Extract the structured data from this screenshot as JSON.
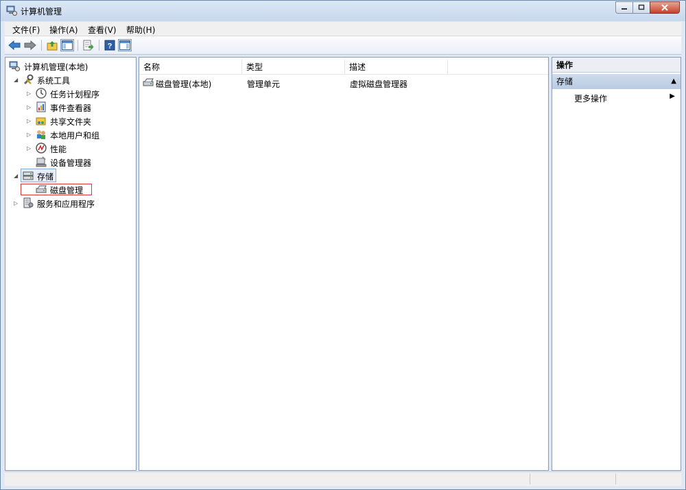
{
  "window": {
    "title": "计算机管理"
  },
  "menubar": {
    "items": [
      "文件(F)",
      "操作(A)",
      "查看(V)",
      "帮助(H)"
    ]
  },
  "tree": {
    "root": "计算机管理(本地)",
    "system_tools": "系统工具",
    "task_scheduler": "任务计划程序",
    "event_viewer": "事件查看器",
    "shared_folders": "共享文件夹",
    "local_users": "本地用户和组",
    "performance": "性能",
    "device_manager": "设备管理器",
    "storage": "存储",
    "disk_management": "磁盘管理",
    "services_apps": "服务和应用程序"
  },
  "list": {
    "columns": [
      "名称",
      "类型",
      "描述"
    ],
    "rows": [
      {
        "name": "磁盘管理(本地)",
        "type": "管理单元",
        "desc": "虚拟磁盘管理器"
      }
    ]
  },
  "actions": {
    "title": "操作",
    "section": "存储",
    "more": "更多操作"
  },
  "colors": {
    "selection_border": "#d43a3a",
    "accent": "#c4d6ec"
  }
}
